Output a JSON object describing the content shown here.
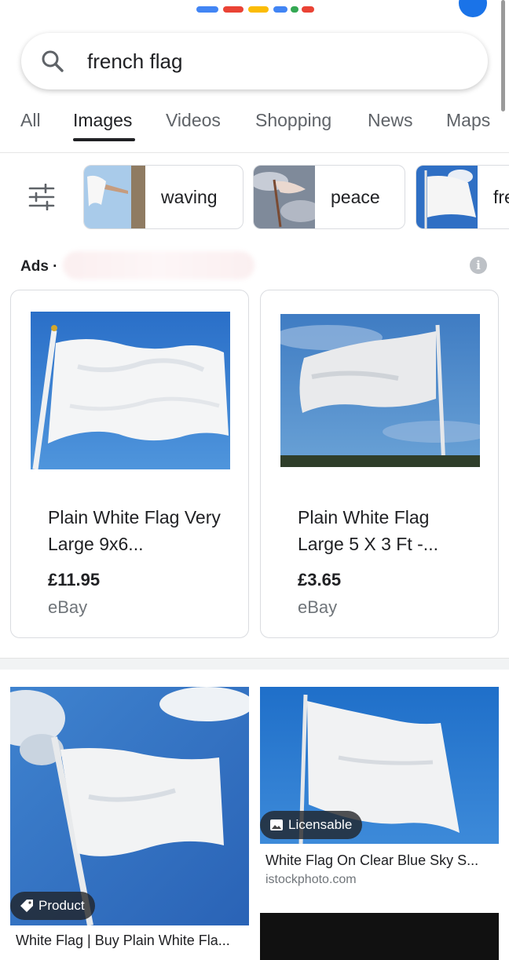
{
  "search": {
    "query": "french flag"
  },
  "tabs": [
    {
      "label": "All"
    },
    {
      "label": "Images",
      "active": true
    },
    {
      "label": "Videos"
    },
    {
      "label": "Shopping"
    },
    {
      "label": "News"
    },
    {
      "label": "Maps"
    }
  ],
  "chips": [
    {
      "label": "waving"
    },
    {
      "label": "peace"
    },
    {
      "label": "fre"
    }
  ],
  "ads": {
    "label": "Ads ·",
    "info_icon": "i"
  },
  "products": [
    {
      "title": "Plain White Flag Very Large 9x6...",
      "price": "£11.95",
      "store": "eBay"
    },
    {
      "title": "Plain White Flag Large 5 X 3 Ft -...",
      "price": "£3.65",
      "store": "eBay"
    }
  ],
  "results": [
    {
      "badge": "Product",
      "title": "White Flag | Buy Plain White Fla..."
    },
    {
      "badge": "Licensable",
      "title": "White Flag On Clear Blue Sky S...",
      "source": "istockphoto.com"
    }
  ],
  "colors": {
    "sky_blue": "#1f6fc9",
    "active_tab": "#202124",
    "badge_bg": "#202124"
  }
}
